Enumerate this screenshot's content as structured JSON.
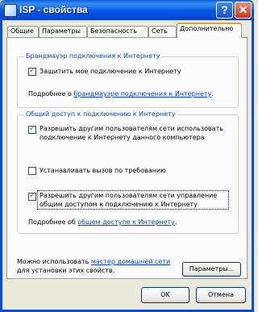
{
  "window": {
    "title": "ISP - свойства",
    "help_label": "?",
    "close_label": "✕"
  },
  "tabs": [
    {
      "label": "Общие"
    },
    {
      "label": "Параметры"
    },
    {
      "label": "Безопасность"
    },
    {
      "label": "Сеть"
    },
    {
      "label": "Дополнительно"
    }
  ],
  "firewall": {
    "legend": "Брандмауэр подключения к Интернету",
    "checkbox_label": "Защитить мое подключение к Интернету",
    "checked": true,
    "more_prefix": "Подробнее о ",
    "more_link": "брандмауэре подключения к Интернету",
    "more_suffix": "."
  },
  "sharing": {
    "legend": "Общий доступ к подключению к Интернету",
    "allow_line1": "Разрешить другим пользователям сети использовать",
    "allow_line2": "подключение к Интернету данного компьютера",
    "allow_checked": true,
    "dial_label": "Устанавливать вызов по требованию",
    "dial_checked": false,
    "control_line1": "Разрешить другим пользователям сети управление",
    "control_line2": "общим доступом к подключению к Интернету",
    "control_checked": true,
    "more_prefix": "Подробнее об ",
    "more_link": "общем доступе к Интернету",
    "more_suffix": "."
  },
  "bottom": {
    "text_prefix": "Можно использовать ",
    "wizard_link": "мастер домашней сети",
    "text_line2": "для установки этих свойств.",
    "settings_button": "Параметры..."
  },
  "footer": {
    "ok": "OK",
    "cancel": "Отмена"
  }
}
